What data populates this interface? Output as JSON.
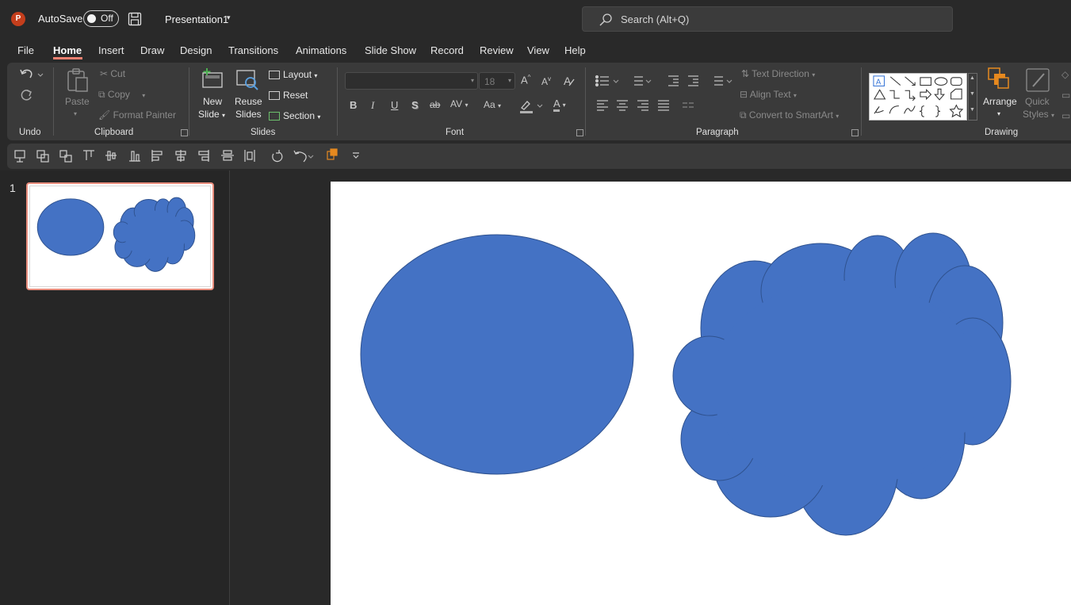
{
  "app": {
    "logo_letter": "P"
  },
  "titlebar": {
    "autosave_label": "AutoSave",
    "autosave_state": "Off",
    "document_title": "Presentation1",
    "search_placeholder": "Search (Alt+Q)"
  },
  "tabs": [
    {
      "label": "File"
    },
    {
      "label": "Home"
    },
    {
      "label": "Insert"
    },
    {
      "label": "Draw"
    },
    {
      "label": "Design"
    },
    {
      "label": "Transitions"
    },
    {
      "label": "Animations"
    },
    {
      "label": "Slide Show"
    },
    {
      "label": "Record"
    },
    {
      "label": "Review"
    },
    {
      "label": "View"
    },
    {
      "label": "Help"
    }
  ],
  "active_tab": "Home",
  "ribbon": {
    "groups": {
      "undo": "Undo",
      "clipboard": "Clipboard",
      "slides": "Slides",
      "font": "Font",
      "paragraph": "Paragraph",
      "drawing": "Drawing"
    },
    "clipboard": {
      "paste": "Paste",
      "cut": "Cut",
      "copy": "Copy",
      "format_painter": "Format Painter"
    },
    "slides": {
      "new_slide_1": "New",
      "new_slide_2": "Slide",
      "reuse_1": "Reuse",
      "reuse_2": "Slides",
      "layout": "Layout",
      "reset": "Reset",
      "section": "Section"
    },
    "font": {
      "font_name": "",
      "font_size": "18",
      "grow": "A",
      "shrink": "A",
      "bold": "B",
      "italic": "I",
      "underline": "U",
      "shadow": "S",
      "strike": "ab",
      "spacing": "AV",
      "case": "Aa",
      "color_letter": "A"
    },
    "paragraph": {
      "text_direction": "Text Direction",
      "align_text": "Align Text",
      "convert_smartart": "Convert to SmartArt"
    },
    "drawing": {
      "arrange": "Arrange",
      "quick_1": "Quick",
      "quick_2": "Styles"
    }
  },
  "slides_pane": {
    "slide_number": "1"
  },
  "colors": {
    "accent": "#ef8070",
    "shape_fill": "#4472c4",
    "shape_stroke": "#2f528f"
  }
}
